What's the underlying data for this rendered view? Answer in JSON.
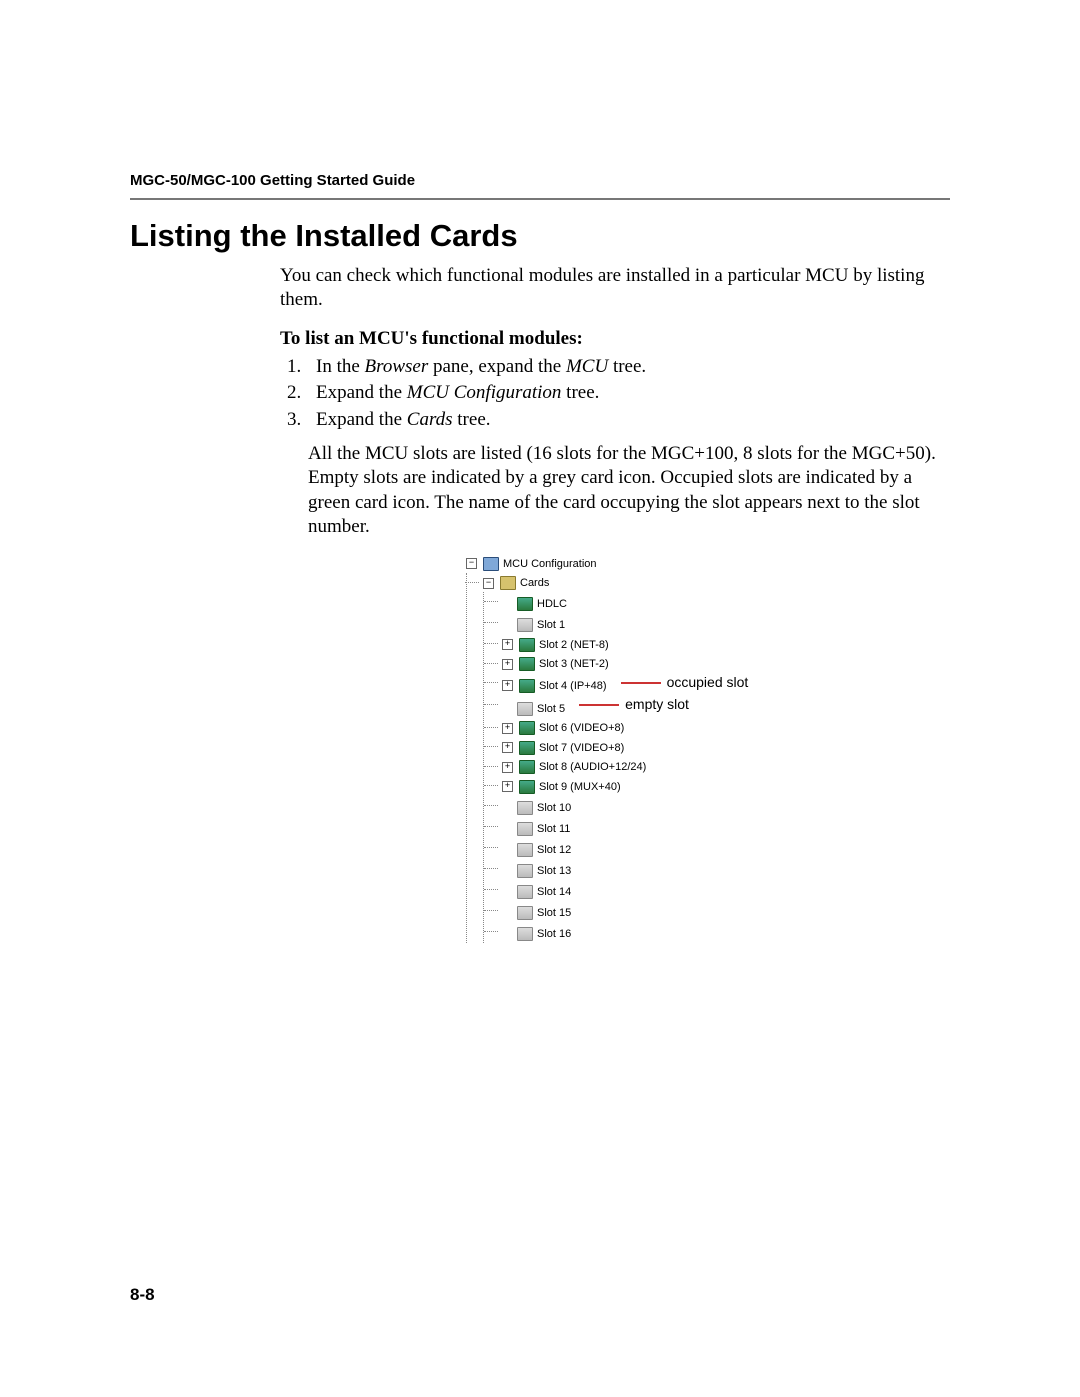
{
  "running_head": "MGC-50/MGC-100 Getting Started Guide",
  "section_title": "Listing the Installed Cards",
  "intro": "You can check which functional modules are installed in a particular MCU by listing them.",
  "subhead": "To list an MCU's functional modules:",
  "steps": [
    {
      "pre": "In the ",
      "em1": "Browser",
      "mid": " pane, expand the ",
      "em2": "MCU",
      "post": " tree."
    },
    {
      "pre": "Expand the ",
      "em1": "MCU Configuration",
      "mid": "",
      "em2": "",
      "post": " tree."
    },
    {
      "pre": "Expand the ",
      "em1": "Cards",
      "mid": "",
      "em2": "",
      "post": " tree."
    }
  ],
  "step_note": "All the MCU slots are listed (16 slots for the MGC+100, 8 slots for the MGC+50). Empty slots are indicated by a grey card icon. Occupied slots are indicated by a green card icon. The name of the card occupying the slot appears next to the slot number.",
  "tree": {
    "root": "MCU Configuration",
    "cards_label": "Cards",
    "items": [
      {
        "label": "HDLC",
        "occupied": true,
        "expandable": false
      },
      {
        "label": "Slot 1",
        "occupied": false,
        "expandable": false
      },
      {
        "label": "Slot 2 (NET-8)",
        "occupied": true,
        "expandable": true
      },
      {
        "label": "Slot 3 (NET-2)",
        "occupied": true,
        "expandable": true
      },
      {
        "label": "Slot 4 (IP+48)",
        "occupied": true,
        "expandable": true,
        "callout": "occupied slot"
      },
      {
        "label": "Slot 5",
        "occupied": false,
        "expandable": false,
        "callout": "empty slot"
      },
      {
        "label": "Slot 6 (VIDEO+8)",
        "occupied": true,
        "expandable": true
      },
      {
        "label": "Slot 7 (VIDEO+8)",
        "occupied": true,
        "expandable": true
      },
      {
        "label": "Slot 8 (AUDIO+12/24)",
        "occupied": true,
        "expandable": true
      },
      {
        "label": "Slot 9 (MUX+40)",
        "occupied": true,
        "expandable": true
      },
      {
        "label": "Slot 10",
        "occupied": false,
        "expandable": false
      },
      {
        "label": "Slot 11",
        "occupied": false,
        "expandable": false
      },
      {
        "label": "Slot 12",
        "occupied": false,
        "expandable": false
      },
      {
        "label": "Slot 13",
        "occupied": false,
        "expandable": false
      },
      {
        "label": "Slot 14",
        "occupied": false,
        "expandable": false
      },
      {
        "label": "Slot 15",
        "occupied": false,
        "expandable": false
      },
      {
        "label": "Slot 16",
        "occupied": false,
        "expandable": false
      }
    ]
  },
  "page_number": "8-8"
}
